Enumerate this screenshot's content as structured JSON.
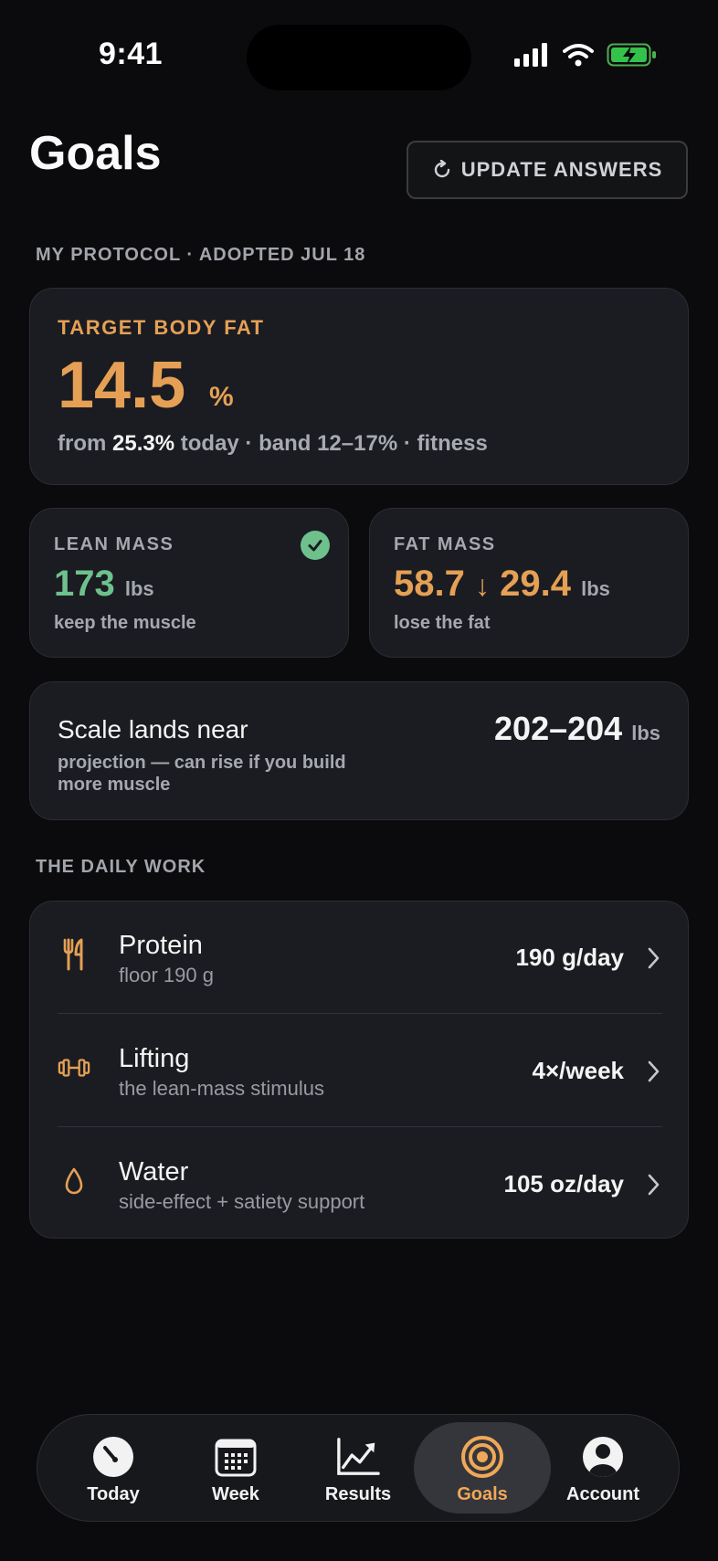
{
  "status_bar": {
    "time": "9:41"
  },
  "header": {
    "title": "Goals",
    "update_button": "UPDATE ANSWERS"
  },
  "protocol": {
    "section_label": "MY PROTOCOL · ADOPTED JUL 18",
    "target": {
      "label": "TARGET BODY FAT",
      "value": "14.5",
      "unit": "%",
      "sub_prefix": "from",
      "sub_current": "25.3%",
      "sub_suffix": "today · band 12–17% · fitness"
    },
    "lean_mass": {
      "label": "LEAN MASS",
      "value": "173",
      "unit": "lbs",
      "sub": "keep the muscle"
    },
    "fat_mass": {
      "label": "FAT MASS",
      "from": "58.7",
      "arrow": "↓",
      "to": "29.4",
      "unit": "lbs",
      "sub": "lose the fat"
    },
    "scale": {
      "title": "Scale lands near",
      "sub": "projection — can rise if you build more muscle",
      "value": "202–204",
      "unit": "lbs"
    }
  },
  "daily_work": {
    "section_label": "THE DAILY WORK",
    "items": [
      {
        "title": "Protein",
        "sub": "floor 190 g",
        "value": "190 g/day",
        "icon": "fork-knife-icon"
      },
      {
        "title": "Lifting",
        "sub": "the lean-mass stimulus",
        "value": "4×/week",
        "icon": "dumbbell-icon"
      },
      {
        "title": "Water",
        "sub": "side-effect + satiety support",
        "value": "105 oz/day",
        "icon": "water-drop-icon"
      }
    ]
  },
  "tabbar": {
    "active": "Goals",
    "tabs": [
      {
        "label": "Today",
        "icon": "clock-icon"
      },
      {
        "label": "Week",
        "icon": "calendar-icon"
      },
      {
        "label": "Results",
        "icon": "chart-icon"
      },
      {
        "label": "Goals",
        "icon": "target-icon"
      },
      {
        "label": "Account",
        "icon": "person-icon"
      }
    ]
  },
  "colors": {
    "accent": "#e5a055",
    "lean": "#6ec08d",
    "background": "#0b0b0d",
    "card": "#1a1c21"
  }
}
